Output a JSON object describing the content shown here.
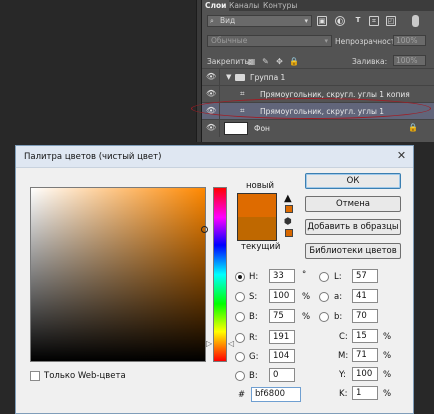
{
  "layers_panel": {
    "tabs": [
      "Слои",
      "Каналы",
      "Контуры"
    ],
    "filter_value": "Вид",
    "blend_mode": "Обычные",
    "opacity_label": "Непрозрачность:",
    "opacity_value": "100%",
    "lock_label": "Закрепить:",
    "fill_label": "Заливка:",
    "fill_value": "100%",
    "layers": [
      {
        "name": "Группа 1",
        "type": "group"
      },
      {
        "name": "Прямоугольник, скругл. углы 1 копия",
        "type": "shape"
      },
      {
        "name": "Прямоугольник, скругл. углы 1",
        "type": "shape",
        "selected": true
      },
      {
        "name": "Фон",
        "type": "background"
      }
    ]
  },
  "dialog": {
    "title": "Палитра цветов (чистый цвет)",
    "new_label": "новый",
    "current_label": "текущий",
    "new_color": "#de6b00",
    "current_color": "#bf6800",
    "buttons": {
      "ok": "ОК",
      "cancel": "Отмена",
      "add_swatches": "Добавить в образцы",
      "color_libraries": "Библиотеки цветов"
    },
    "web_only_label": "Только Web-цвета",
    "hsb": {
      "h_label": "H:",
      "h_value": "33",
      "h_unit": "°",
      "s_label": "S:",
      "s_value": "100",
      "s_unit": "%",
      "b_label": "B:",
      "b_value": "75",
      "b_unit": "%"
    },
    "rgb": {
      "r_label": "R:",
      "r_value": "191",
      "g_label": "G:",
      "g_value": "104",
      "b_label": "B:",
      "b_value": "0"
    },
    "lab": {
      "l_label": "L:",
      "l_value": "57",
      "a_label": "a:",
      "a_value": "41",
      "b_label": "b:",
      "b_value": "70"
    },
    "cmyk": {
      "c_label": "C:",
      "c_value": "15",
      "c_unit": "%",
      "m_label": "M:",
      "m_value": "71",
      "m_unit": "%",
      "y_label": "Y:",
      "y_value": "100",
      "y_unit": "%",
      "k_label": "K:",
      "k_value": "1",
      "k_unit": "%"
    },
    "hex_label": "#",
    "hex_value": "bf6800"
  }
}
